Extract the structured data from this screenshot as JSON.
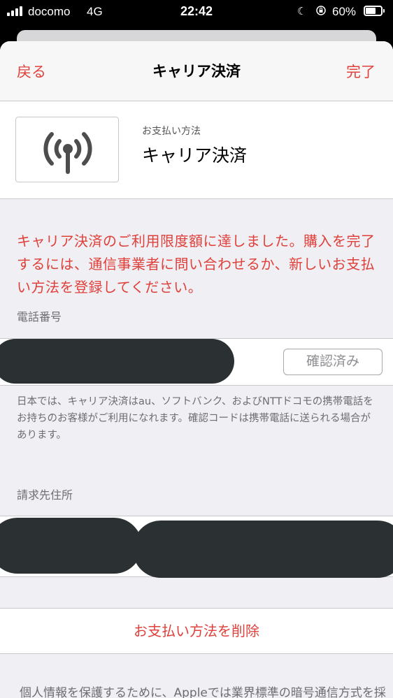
{
  "status_bar": {
    "carrier": "docomo",
    "network": "4G",
    "time": "22:42",
    "battery_percent": "60%",
    "icons": [
      "signal-bars-icon",
      "moon-icon",
      "rotation-lock-icon",
      "battery-icon"
    ]
  },
  "nav": {
    "back_label": "戻る",
    "title": "キャリア決済",
    "done_label": "完了"
  },
  "payment_method": {
    "icon": "antenna-icon",
    "caption": "お支払い方法",
    "name": "キャリア決済"
  },
  "error": {
    "message": "キャリア決済のご利用限度額に達しました。購入を完了するには、通信事業者に問い合わせるか、新しいお支払い方法を登録してください。"
  },
  "phone": {
    "label": "電話番号",
    "verified_label": "確認済み"
  },
  "note": "日本では、キャリア決済はau、ソフトバンク、およびNTTドコモの携帯電話をお持ちのお客様がご利用になれます。確認コードは携帯電話に送られる場合があります。",
  "billing_address": {
    "label": "請求先住所"
  },
  "delete_button_label": "お支払い方法を削除",
  "footer": "個人情報を保護するために、Appleでは業界標準の暗号通信方式を採",
  "colors": {
    "accent": "#e0403a",
    "background": "#efeff4",
    "secondary_text": "#6d6d72"
  }
}
